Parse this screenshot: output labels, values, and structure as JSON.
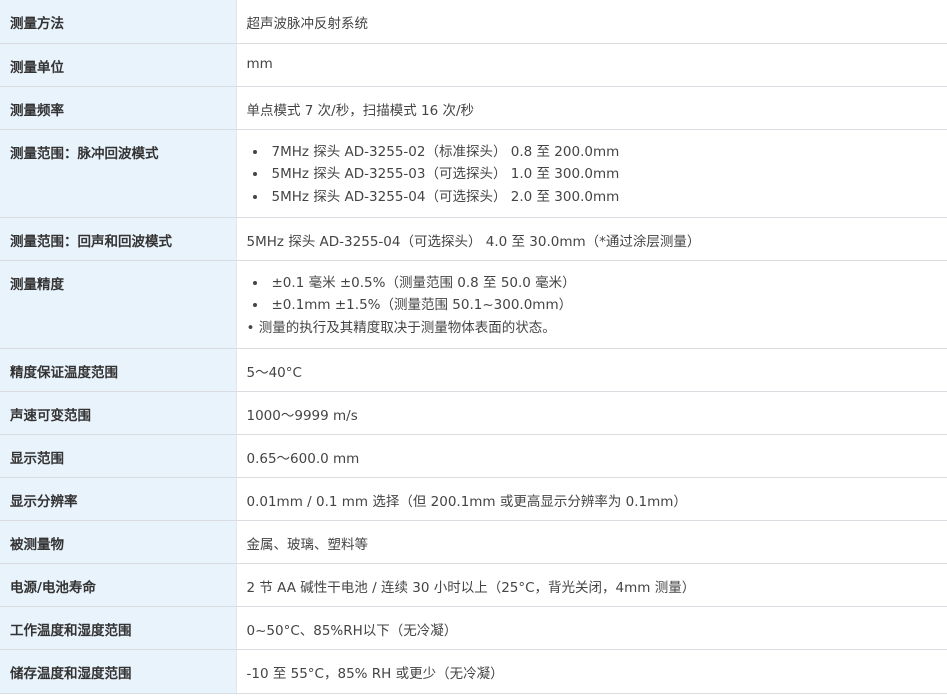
{
  "specs": [
    {
      "label": "测量方法",
      "value": "超声波脉冲反射系统"
    },
    {
      "label": "测量单位",
      "value": "mm"
    },
    {
      "label": "测量频率",
      "value": "单点模式 7 次/秒，扫描模式 16 次/秒"
    },
    {
      "label": "测量范围：脉冲回波模式",
      "items": [
        "7MHz 探头 AD-3255-02（标准探头） 0.8 至 200.0mm",
        "5MHz 探头 AD-3255-03（可选探头） 1.0 至 300.0mm",
        "5MHz 探头 AD-3255-04（可选探头） 2.0 至 300.0mm"
      ]
    },
    {
      "label": "测量范围：回声和回波模式",
      "value": "5MHz 探头 AD-3255-04（可选探头） 4.0 至 30.0mm（*通过涂层测量）"
    },
    {
      "label": "测量精度",
      "items": [
        "±0.1 毫米 ±0.5%（测量范围 0.8 至 50.0 毫米）",
        "±0.1mm ±1.5%（测量范围 50.1~300.0mm）"
      ],
      "note": "• 测量的执行及其精度取决于测量物体表面的状态。"
    },
    {
      "label": "精度保证温度范围",
      "value": "5～40°C"
    },
    {
      "label": "声速可变范围",
      "value": "1000～9999 m/s"
    },
    {
      "label": "显示范围",
      "value": "0.65～600.0 mm"
    },
    {
      "label": "显示分辨率",
      "value": "0.01mm / 0.1 mm 选择（但 200.1mm 或更高显示分辨率为 0.1mm）"
    },
    {
      "label": "被测量物",
      "value": "金属、玻璃、塑料等"
    },
    {
      "label": "电源/电池寿命",
      "value": "2 节 AA 碱性干电池 / 连续 30 小时以上（25°C，背光关闭，4mm 测量）"
    },
    {
      "label": "工作温度和湿度范围",
      "value": "0~50°C、85%RH以下（无冷凝）"
    },
    {
      "label": "储存温度和湿度范围",
      "value": "-10 至 55°C，85% RH 或更少（无冷凝）"
    }
  ]
}
